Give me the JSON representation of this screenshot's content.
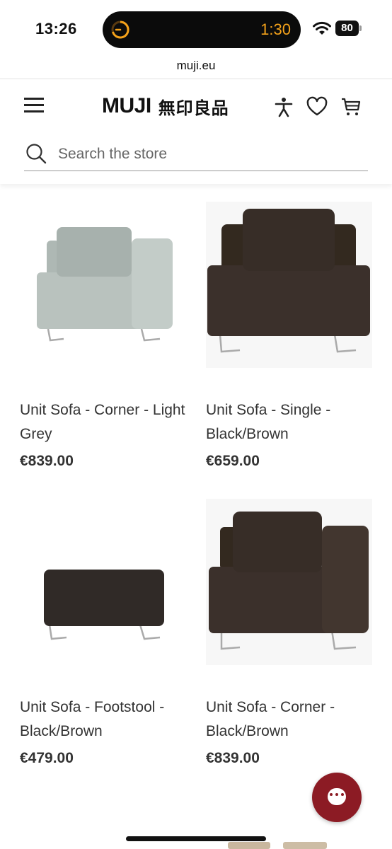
{
  "status_bar": {
    "time": "13:26",
    "timer": "1:30",
    "battery": "80"
  },
  "browser": {
    "url": "muji.eu"
  },
  "header": {
    "logo_latin": "MUJI",
    "logo_kanji": "無印良品",
    "search_placeholder": "Search the store"
  },
  "products": [
    {
      "name": "Unit Sofa - Corner - Light Grey",
      "price": "€839.00"
    },
    {
      "name": "Unit Sofa - Single - Black/Brown",
      "price": "€659.00"
    },
    {
      "name": "Unit Sofa - Footstool - Black/Brown",
      "price": "€479.00"
    },
    {
      "name": "Unit Sofa - Corner - Black/Brown",
      "price": "€839.00"
    }
  ],
  "colors": {
    "accent": "#8c1b24",
    "timer": "#f5a21a",
    "text": "#333333",
    "sofa_grey": "#b9c2be",
    "sofa_brown": "#3b302b"
  },
  "icons": [
    "menu-icon",
    "accessibility-icon",
    "heart-icon",
    "cart-icon",
    "search-icon",
    "chat-icon",
    "wifi-icon",
    "timer-icon"
  ]
}
